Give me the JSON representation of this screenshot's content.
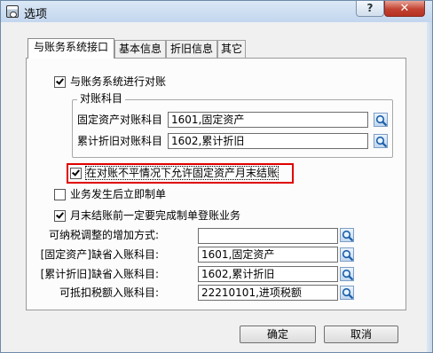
{
  "window": {
    "title": "选项",
    "help_label": "?",
    "close_label": "✕"
  },
  "tabs": [
    {
      "label": "与账务系统接口",
      "active": true
    },
    {
      "label": "基本信息",
      "active": false
    },
    {
      "label": "折旧信息",
      "active": false
    },
    {
      "label": "其它",
      "active": false
    }
  ],
  "reconcile": {
    "label": "与账务系统进行对账",
    "checked": true
  },
  "account_group": {
    "title": "对账科目",
    "fixed_asset": {
      "label": "固定资产对账科目",
      "value": "1601,固定资产"
    },
    "accum_depr": {
      "label": "累计折旧对账科目",
      "value": "1602,累计折旧"
    }
  },
  "allow_close": {
    "label": "在对账不平情况下允许固定资产月末结账",
    "checked": true
  },
  "immediate_voucher": {
    "label": "业务发生后立即制单",
    "checked": false
  },
  "must_finish": {
    "label": "月末结账前一定要完成制单登账业务",
    "checked": true
  },
  "defaults": [
    {
      "label": "可纳税调整的增加方式:",
      "value": ""
    },
    {
      "label": "[固定资产]缺省入账科目:",
      "value": "1601,固定资产"
    },
    {
      "label": "[累计折旧]缺省入账科目:",
      "value": "1602,累计折旧"
    },
    {
      "label": "可抵扣税额入账科目:",
      "value": "22210101,进项税额"
    }
  ],
  "buttons": {
    "ok": "确定",
    "cancel": "取消"
  },
  "colors": {
    "highlight": "#e00000",
    "title_bar": "#c3d6ee",
    "close_button": "#c34232"
  },
  "icons": {
    "app": "app-icon",
    "lookup": "search-icon"
  }
}
